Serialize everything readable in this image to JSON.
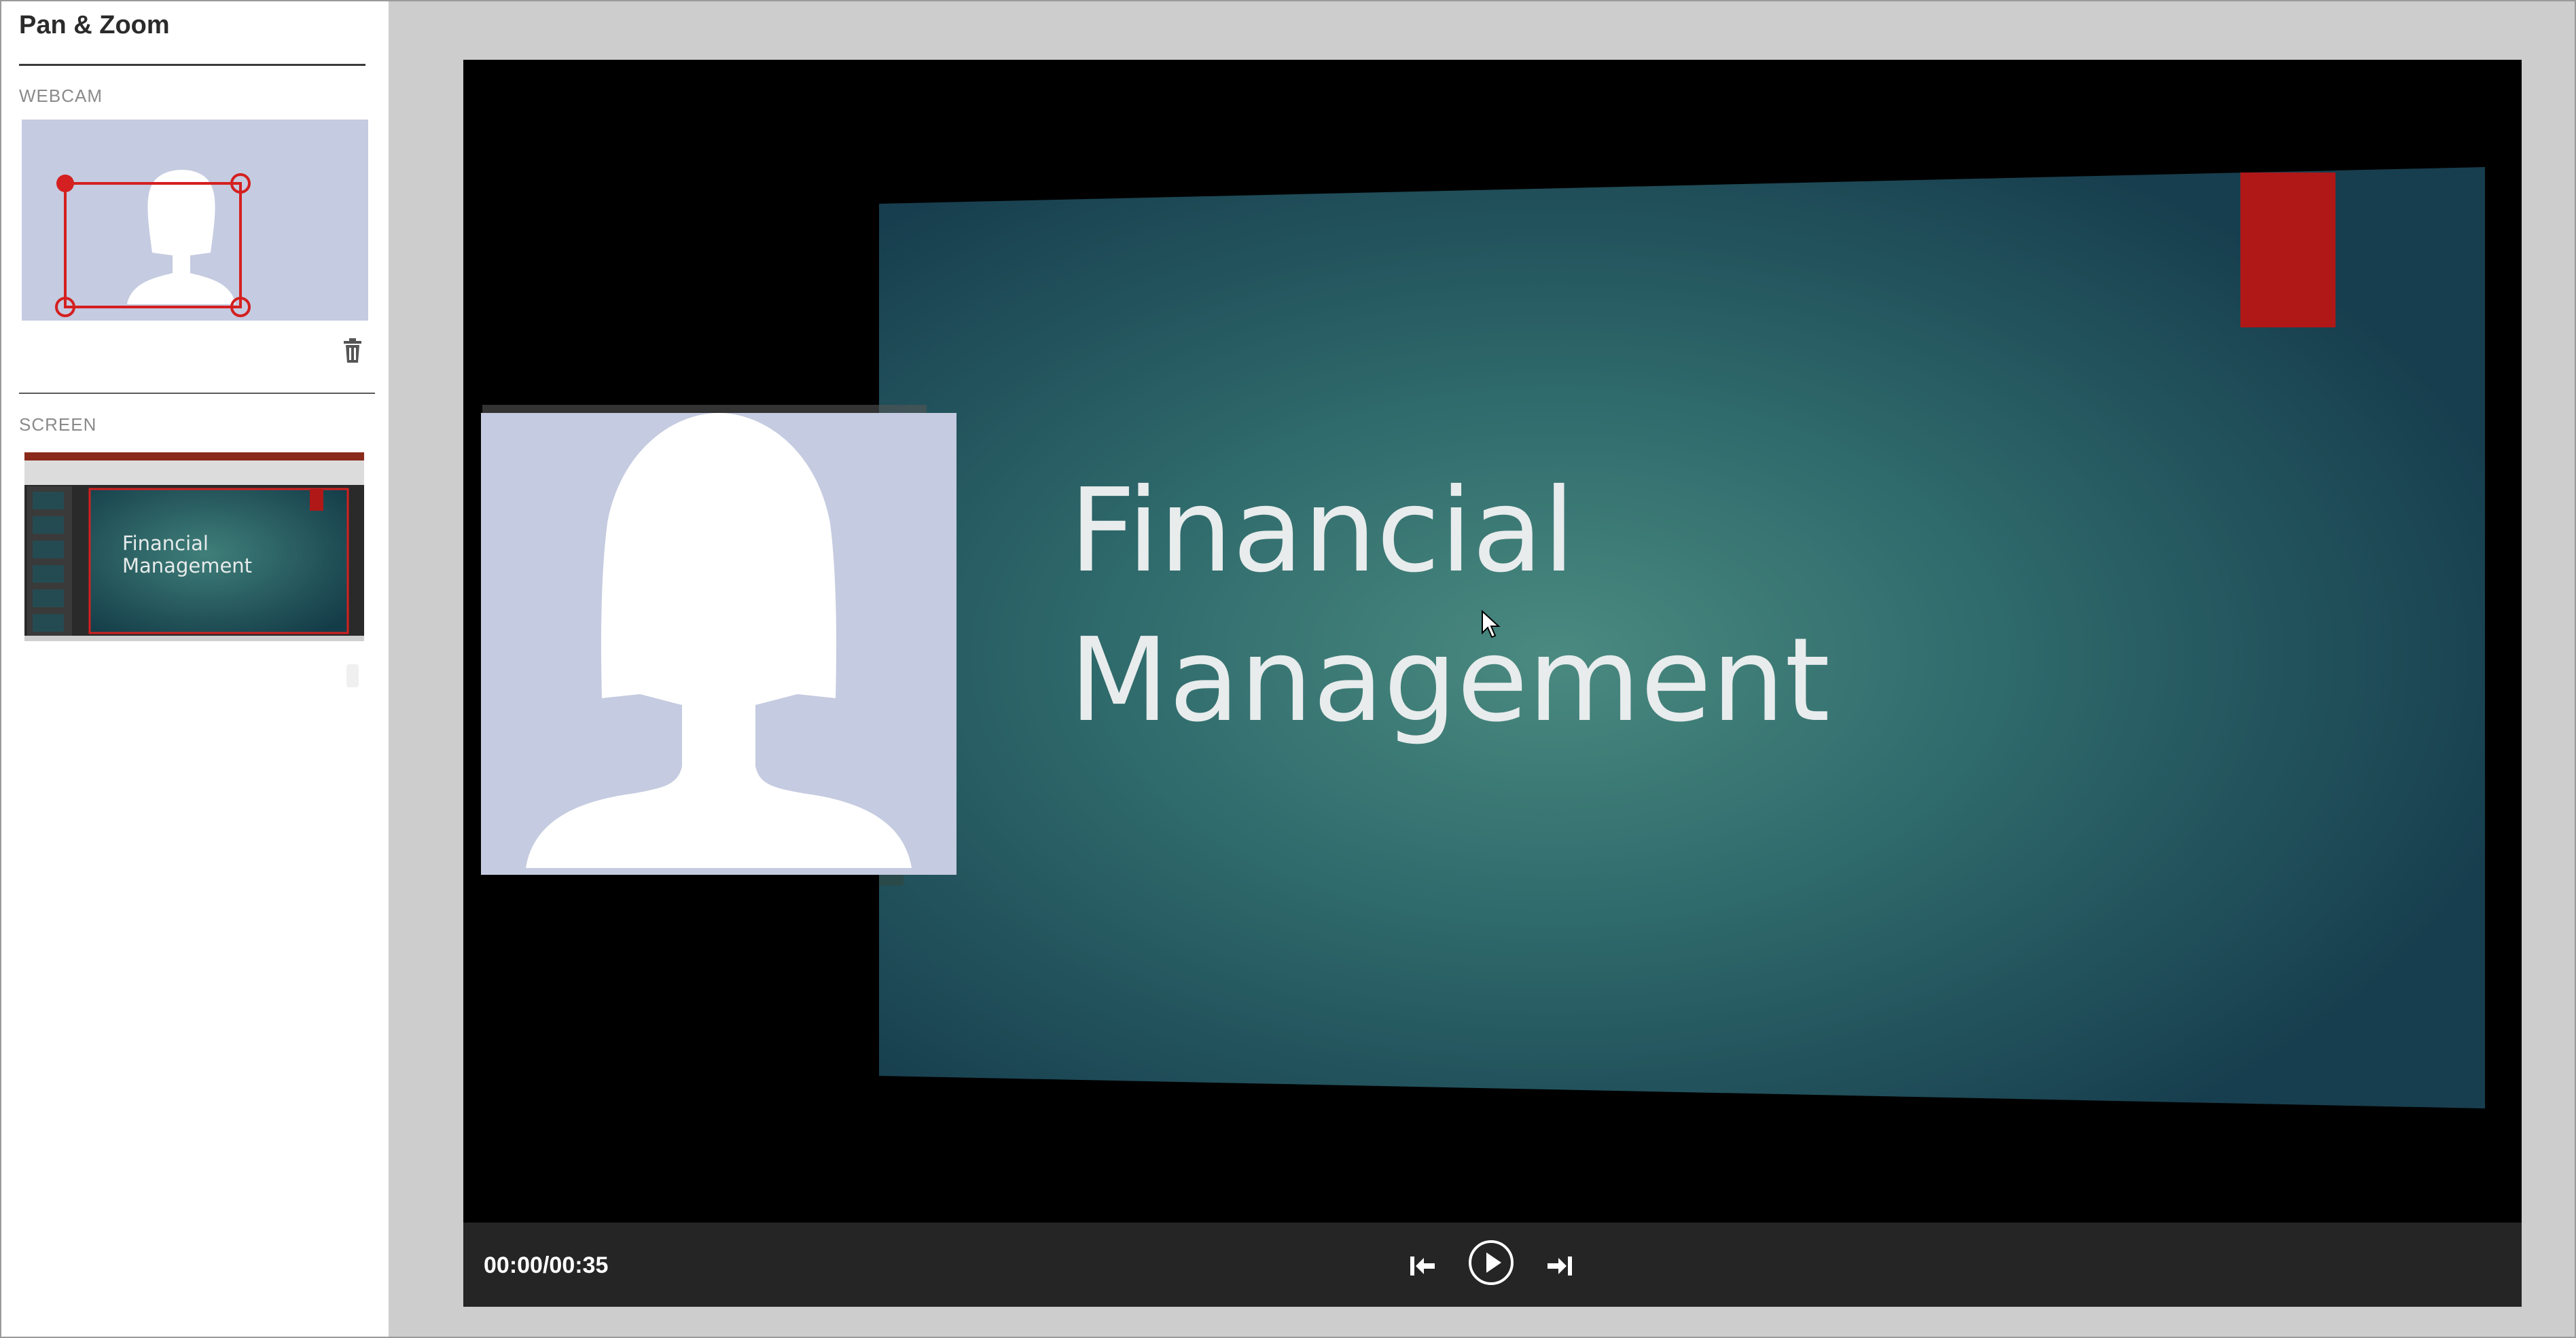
{
  "panel": {
    "title": "Pan & Zoom",
    "webcam_label": "WEBCAM",
    "screen_label": "SCREEN"
  },
  "slide": {
    "title_line1": "Financial",
    "title_line2": "Management"
  },
  "player": {
    "time": "00:00/00:35"
  },
  "icons": {
    "trash": "trash-icon",
    "skip_start": "skip-to-start-icon",
    "play": "play-icon",
    "skip_end": "skip-to-end-icon"
  },
  "colors": {
    "accent_red": "#d42020",
    "slide_teal": "#3f7f7a",
    "webcam_bg": "#c5cbe0",
    "control_bar": "#252525"
  }
}
